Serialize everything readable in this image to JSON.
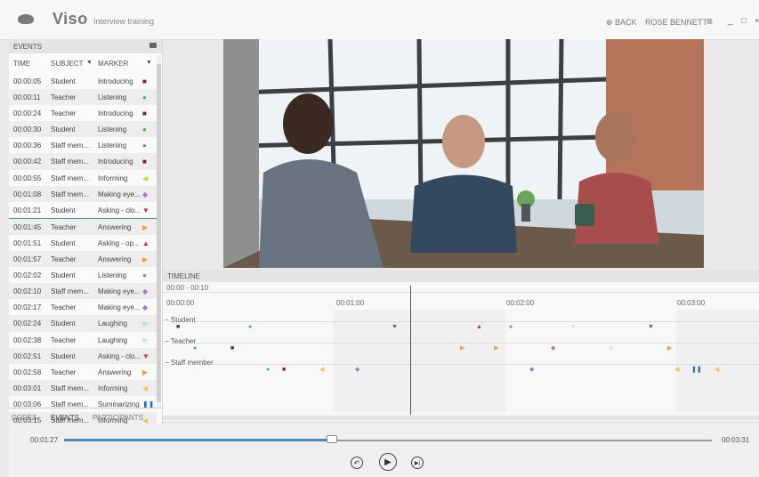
{
  "app": {
    "name": "Viso",
    "subtitle": "Interview training"
  },
  "header": {
    "back_label": "BACK",
    "user_name": "ROSE BENNETT",
    "menu_icon": "hamburger-menu-icon"
  },
  "events_panel": {
    "title": "EVENTS",
    "columns": [
      "TIME",
      "SUBJECT",
      "MARKER"
    ],
    "rows": [
      {
        "time": "00:00:05",
        "subject": "Student",
        "marker": "Introducing",
        "icon": "■",
        "color": "#8b1a1a"
      },
      {
        "time": "00:00:11",
        "subject": "Teacher",
        "marker": "Listening",
        "icon": "●",
        "color": "#3cb371"
      },
      {
        "time": "00:00:24",
        "subject": "Teacher",
        "marker": "Introducing",
        "icon": "■",
        "color": "#8b1a1a"
      },
      {
        "time": "00:00:30",
        "subject": "Student",
        "marker": "Listening",
        "icon": "●",
        "color": "#3cb371"
      },
      {
        "time": "00:00:36",
        "subject": "Staff mem...",
        "marker": "Listening",
        "icon": "●",
        "color": "#3cb371"
      },
      {
        "time": "00:00:42",
        "subject": "Staff mem...",
        "marker": "Introducing",
        "icon": "■",
        "color": "#8b1a1a"
      },
      {
        "time": "00:00:55",
        "subject": "Staff mem...",
        "marker": "Informing",
        "icon": "◀",
        "color": "#f5c542"
      },
      {
        "time": "00:01:08",
        "subject": "Staff mem...",
        "marker": "Making eye...",
        "icon": "◆",
        "color": "#b070c8"
      },
      {
        "time": "00:01:21",
        "subject": "Student",
        "marker": "Asking - clo...",
        "icon": "▼",
        "color": "#d42a2a"
      },
      {
        "time": "00:01:45",
        "subject": "Teacher",
        "marker": "Answering",
        "icon": "▶",
        "color": "#f0a030"
      },
      {
        "time": "00:01:51",
        "subject": "Student",
        "marker": "Asking - op...",
        "icon": "▲",
        "color": "#d42a2a"
      },
      {
        "time": "00:01:57",
        "subject": "Teacher",
        "marker": "Answering",
        "icon": "▶",
        "color": "#f0a030"
      },
      {
        "time": "00:02:02",
        "subject": "Student",
        "marker": "Listening",
        "icon": "●",
        "color": "#3cb371"
      },
      {
        "time": "00:02:10",
        "subject": "Staff mem...",
        "marker": "Making eye...",
        "icon": "◆",
        "color": "#b070c8"
      },
      {
        "time": "00:02:17",
        "subject": "Teacher",
        "marker": "Making eye...",
        "icon": "◆",
        "color": "#b070c8"
      },
      {
        "time": "00:02:24",
        "subject": "Student",
        "marker": "Laughing",
        "icon": "○",
        "color": "#2a90d0"
      },
      {
        "time": "00:02:38",
        "subject": "Teacher",
        "marker": "Laughing",
        "icon": "○",
        "color": "#2a90d0"
      },
      {
        "time": "00:02:51",
        "subject": "Student",
        "marker": "Asking - clo...",
        "icon": "▼",
        "color": "#d42a2a"
      },
      {
        "time": "00:02:58",
        "subject": "Teacher",
        "marker": "Answering",
        "icon": "▶",
        "color": "#f0a030"
      },
      {
        "time": "00:03:01",
        "subject": "Staff mem...",
        "marker": "Informing",
        "icon": "◀",
        "color": "#f5c542"
      },
      {
        "time": "00:03:06",
        "subject": "Staff mem...",
        "marker": "Summarizing",
        "icon": "❚❚",
        "color": "#2a70c8"
      },
      {
        "time": "00:03:15",
        "subject": "Staff mem...",
        "marker": "Informing",
        "icon": "◀",
        "color": "#f5c542"
      }
    ],
    "tabs": [
      "CODES",
      "EVENTS",
      "PARTICIPANTS"
    ],
    "active_tab": "EVENTS"
  },
  "timeline": {
    "title": "TIMELINE",
    "range": "00:00 - 00:10",
    "ticks": [
      "00:00:00",
      "00:01:00",
      "00:02:00",
      "00:03:00"
    ],
    "tracks": [
      "Student",
      "Teacher",
      "Staff member"
    ]
  },
  "playback": {
    "current": "00:01:27",
    "total": "00:03:31",
    "progress": 0.412
  }
}
